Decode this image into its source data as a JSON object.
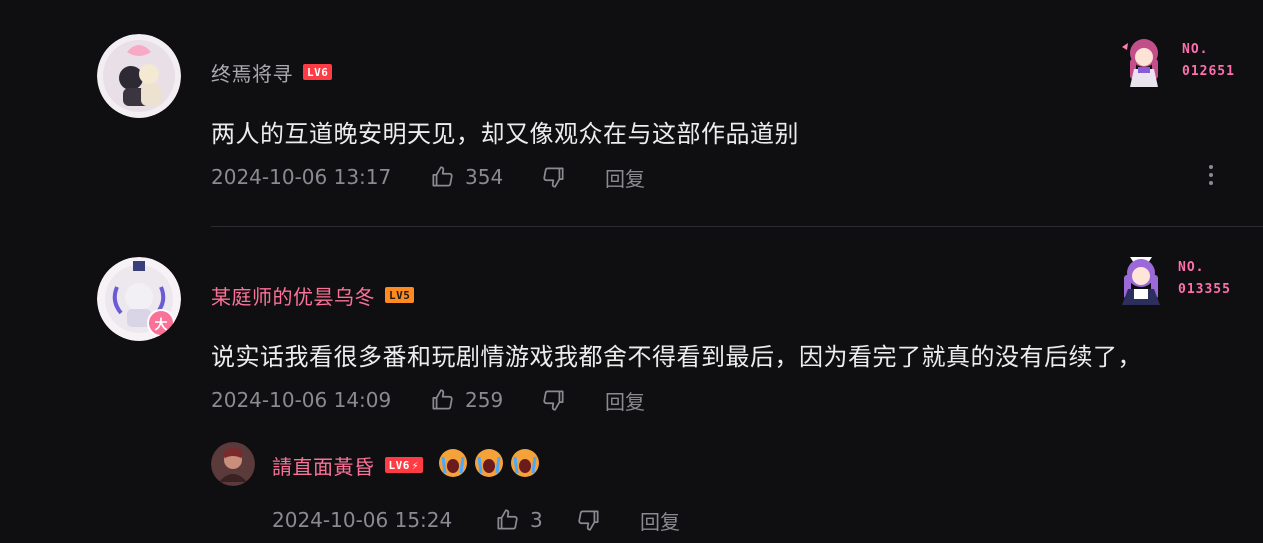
{
  "comments": [
    {
      "username": "终焉将寻",
      "level": "LV6",
      "text": "两人的互道晚安明天见，却又像观众在与这部作品道别",
      "time": "2024-10-06 13:17",
      "likes": "354",
      "reply_label": "回复",
      "badge": {
        "no_label": "NO.",
        "no_value": "012651"
      }
    },
    {
      "username": "某庭师的优昙乌冬",
      "level": "LV5",
      "text": "说实话我看很多番和玩剧情游戏我都舍不得看到最后，因为看完了就真的没有后续了，",
      "time": "2024-10-06 14:09",
      "likes": "259",
      "reply_label": "回复",
      "badge": {
        "no_label": "NO.",
        "no_value": "013355"
      },
      "avatar_badge": "大",
      "sub_reply": {
        "username": "請直面黃昏",
        "level": "LV6",
        "time": "2024-10-06 15:24",
        "likes": "3",
        "reply_label": "回复",
        "emojis": [
          "crying-emoji",
          "crying-emoji",
          "crying-emoji"
        ]
      }
    }
  ],
  "colors": {
    "background": "#0f0f11",
    "pink": "#fb7299",
    "grey_text": "#8a8a90"
  }
}
